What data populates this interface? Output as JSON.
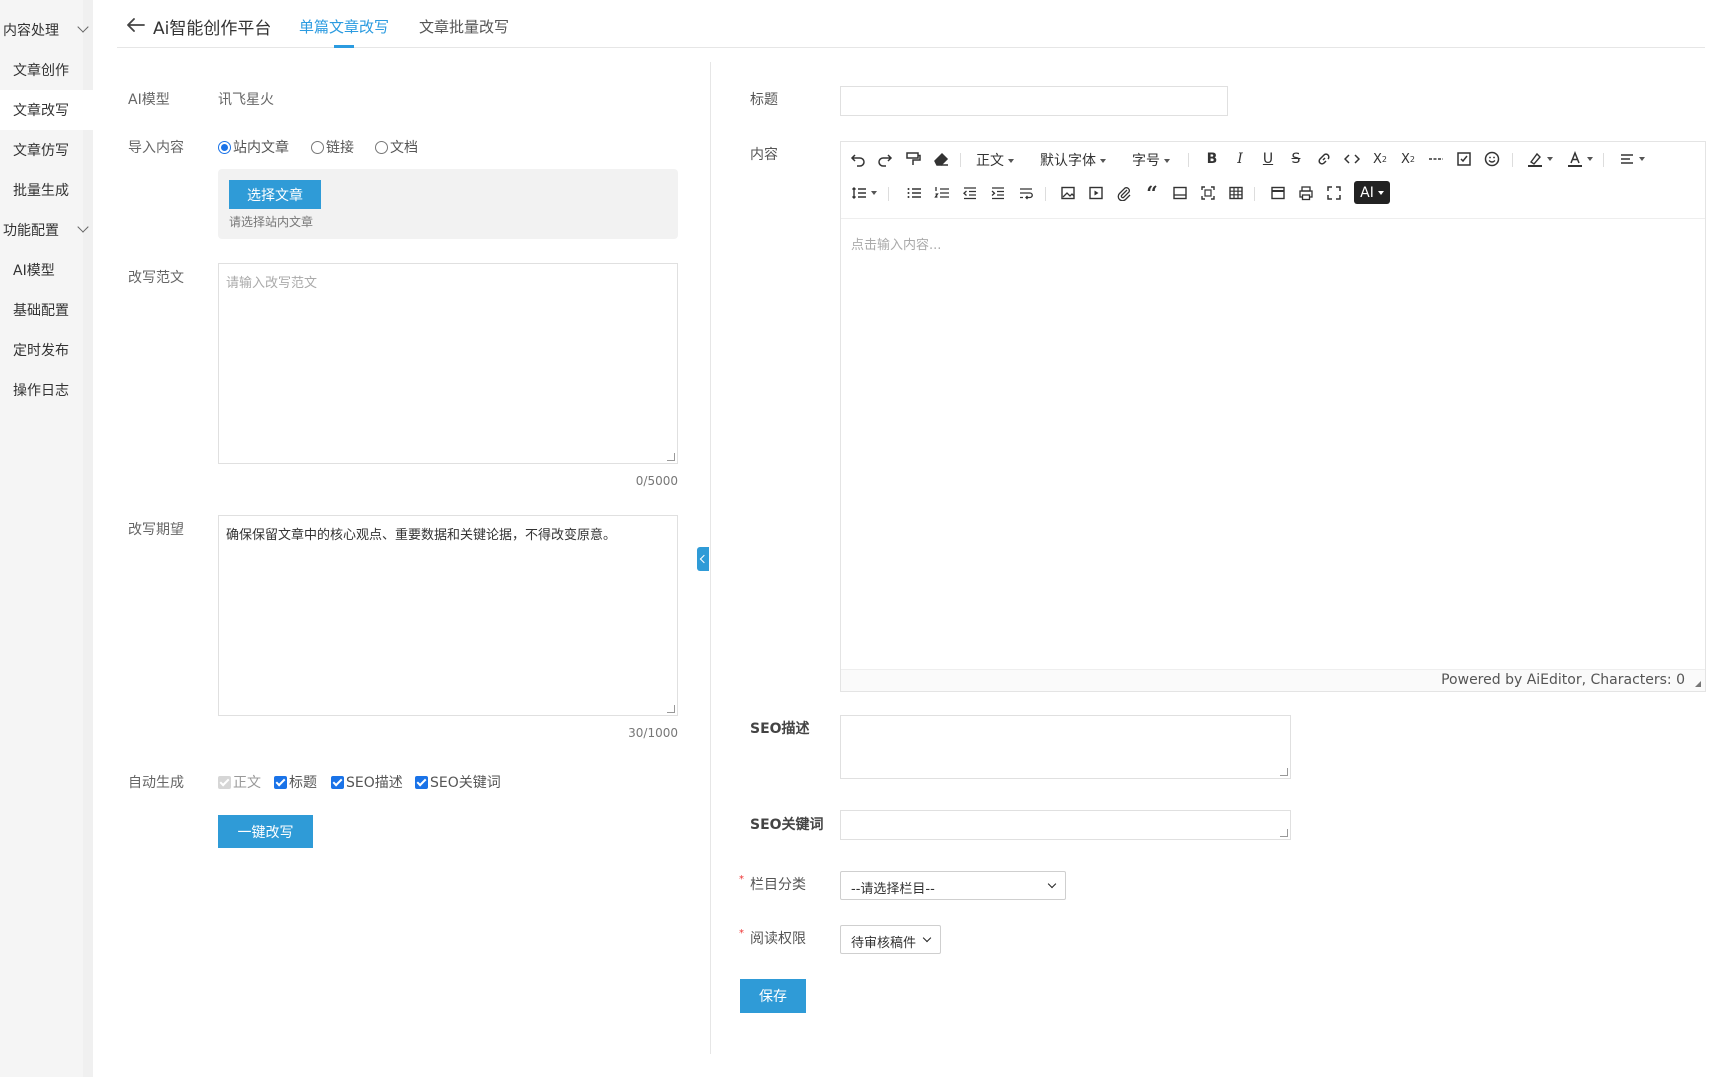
{
  "sidebar": {
    "groups": [
      {
        "label": "内容处理"
      },
      {
        "label": "功能配置"
      }
    ],
    "items": [
      {
        "label": "文章创作"
      },
      {
        "label": "文章改写"
      },
      {
        "label": "文章仿写"
      },
      {
        "label": "批量生成"
      },
      {
        "label": "AI模型"
      },
      {
        "label": "基础配置"
      },
      {
        "label": "定时发布"
      },
      {
        "label": "操作日志"
      }
    ]
  },
  "header": {
    "title": "Ai智能创作平台",
    "tabs": [
      {
        "label": "单篇文章改写",
        "active": true
      },
      {
        "label": "文章批量改写",
        "active": false
      }
    ]
  },
  "left_form": {
    "model_label": "AI模型",
    "model_value": "讯飞星火",
    "import_label": "导入内容",
    "import_options": [
      {
        "label": "站内文章",
        "checked": true
      },
      {
        "label": "链接",
        "checked": false
      },
      {
        "label": "文档",
        "checked": false
      }
    ],
    "select_article_button": "选择文章",
    "select_article_hint": "请选择站内文章",
    "sample_label": "改写范文",
    "sample_placeholder": "请输入改写范文",
    "sample_counter": "0/5000",
    "expect_label": "改写期望",
    "expect_value": "确保保留文章中的核心观点、重要数据和关键论据，不得改变原意。",
    "expect_counter": "30/1000",
    "auto_label": "自动生成",
    "auto_options": [
      {
        "label": "正文",
        "checked": true,
        "disabled": true
      },
      {
        "label": "标题",
        "checked": true,
        "disabled": false
      },
      {
        "label": "SEO描述",
        "checked": true,
        "disabled": false
      },
      {
        "label": "SEO关键词",
        "checked": true,
        "disabled": false
      }
    ],
    "rewrite_button": "一键改写"
  },
  "right_form": {
    "title_label": "标题",
    "title_value": "",
    "content_label": "内容",
    "editor": {
      "dropdowns": [
        "正文",
        "默认字体",
        "字号"
      ],
      "ai_button": "AI",
      "placeholder": "点击输入内容...",
      "footer": "Powered by AiEditor, Characters: 0"
    },
    "seo_desc_label": "SEO描述",
    "seo_kw_label": "SEO关键词",
    "category_label": "栏目分类",
    "category_value": "--请选择栏目--",
    "permission_label": "阅读权限",
    "permission_value": "待审核稿件",
    "save_button": "保存",
    "required_mark": "*"
  },
  "colors": {
    "accent": "#2f9bd7",
    "tab_active": "#2b9be0",
    "checkbox": "#1a73e8"
  }
}
